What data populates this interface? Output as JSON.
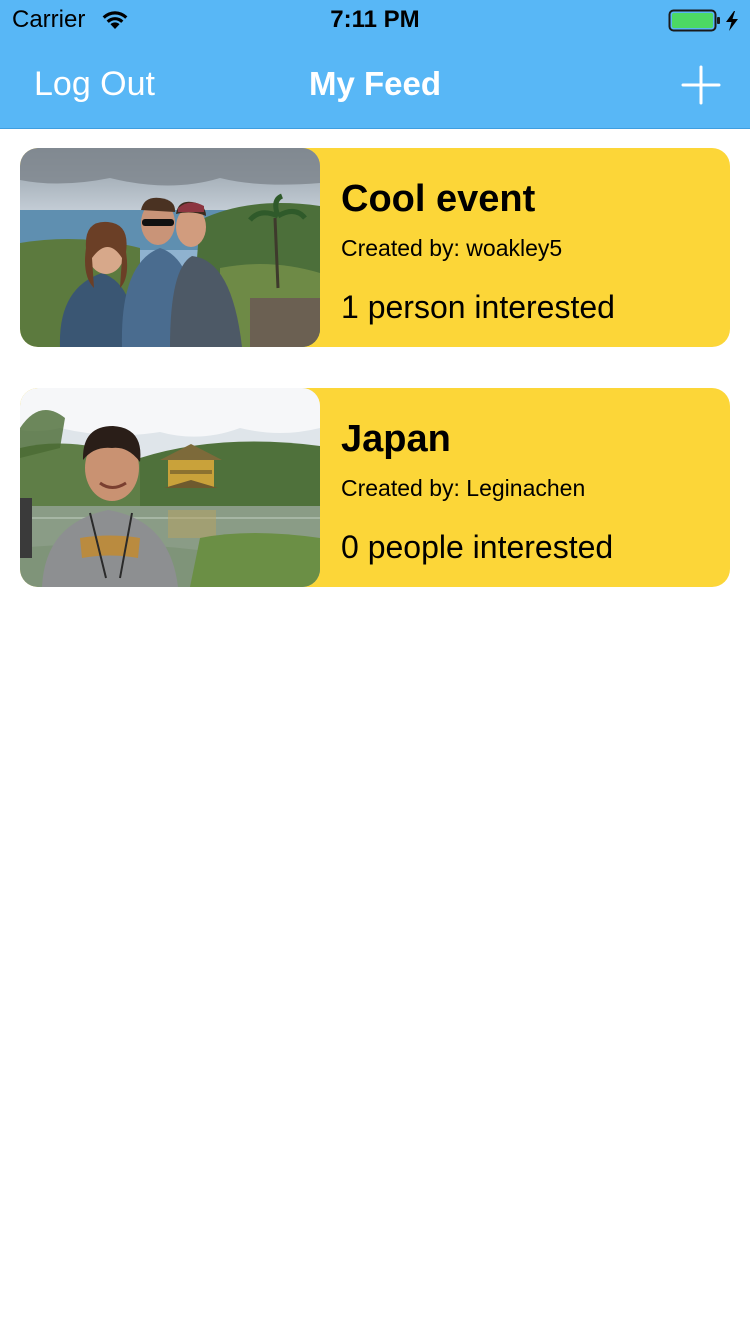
{
  "status_bar": {
    "carrier": "Carrier",
    "time": "7:11 PM",
    "battery_color": "#4cd964"
  },
  "nav_bar": {
    "background": "#58b7f6",
    "left_button_label": "Log Out",
    "title": "My Feed",
    "right_button_icon": "plus-icon"
  },
  "feed": {
    "card_color": "#fcd638",
    "items": [
      {
        "title": "Cool event",
        "created_by": "Created by: woakley5",
        "interest": "1 person interested",
        "photo_icon": "event-photo-coast"
      },
      {
        "title": "Japan",
        "created_by": "Created by: Leginachen",
        "interest": "0 people interested",
        "photo_icon": "event-photo-temple"
      }
    ]
  }
}
